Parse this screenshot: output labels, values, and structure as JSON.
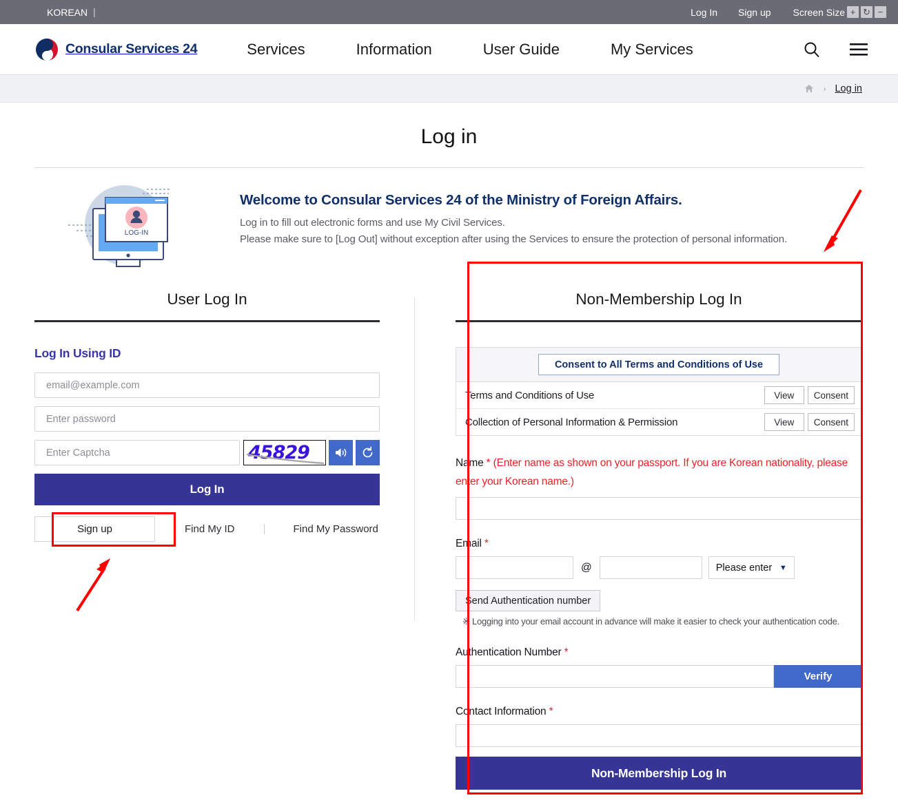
{
  "utilbar": {
    "korean": "KOREAN",
    "separator": "|",
    "login": "Log In",
    "signup": "Sign up",
    "screen_size": "Screen Size",
    "zoom_in": "+",
    "zoom_reset": "↻",
    "zoom_out": "−"
  },
  "header": {
    "logo_text": "Consular Services 24",
    "nav": [
      {
        "label": "Services"
      },
      {
        "label": "Information"
      },
      {
        "label": "User Guide"
      },
      {
        "label": "My Services"
      }
    ],
    "search_icon": "search-icon",
    "menu_icon": "hamburger-menu-icon"
  },
  "breadcrumb": {
    "home_icon": "home-icon",
    "separator": "›",
    "current": "Log in"
  },
  "page": {
    "title": "Log in"
  },
  "welcome": {
    "illustration_label": "LOG-IN",
    "heading": "Welcome to Consular Services 24 of the Ministry of Foreign Affairs.",
    "line1": "Log in to fill out electronic forms and use My Civil Services.",
    "line2": "Please make sure to [Log Out] without exception after using the Services to ensure the protection of personal information."
  },
  "user_login": {
    "panel_title": "User Log In",
    "sub_heading": "Log In Using ID",
    "id_placeholder": "email@example.com",
    "id_value": "",
    "password_placeholder": "Enter password",
    "password_value": "",
    "captcha_placeholder": "Enter Captcha",
    "captcha_value": "",
    "captcha_code": "45829",
    "captcha_audio_icon": "speaker-icon",
    "captcha_refresh_icon": "refresh-icon",
    "login_button": "Log In",
    "signup_button": "Sign up",
    "find_id": "Find My ID",
    "find_password": "Find My Password"
  },
  "non_membership": {
    "panel_title": "Non-Membership Log In",
    "consent_all_button": "Consent to All Terms and Conditions of Use",
    "consent_rows": [
      {
        "label": "Terms and Conditions of Use",
        "view": "View",
        "consent": "Consent"
      },
      {
        "label": "Collection of Personal Information & Permission",
        "view": "View",
        "consent": "Consent"
      }
    ],
    "name_label": "Name",
    "name_required": "*",
    "name_note": "(Enter name as shown on your passport. If you are Korean nationality, please enter your Korean name.)",
    "name_value": "",
    "email_label": "Email",
    "email_required": "*",
    "email_id_value": "",
    "email_at": "@",
    "email_domain_value": "",
    "email_select_value": "Please enter",
    "email_select_caret": "▼",
    "send_auth_button": "Send Authentication number",
    "auth_note": "※ Logging into your email account in advance will make it easier to check your authentication code.",
    "auth_label": "Authentication Number",
    "auth_required": "*",
    "auth_value": "",
    "verify_button": "Verify",
    "contact_label": "Contact Information",
    "contact_required": "*",
    "contact_value": "",
    "submit_button": "Non-Membership Log In"
  },
  "annotations": {
    "highlight_signup": "red-rectangle-around-signup-button",
    "highlight_nonmembership": "red-rectangle-around-non-membership-panel",
    "arrow_to_panel": "red-arrow-pointing-to-non-membership-panel",
    "arrow_to_signup": "red-arrow-pointing-to-signup-button"
  },
  "colors": {
    "brand_navy": "#10306b",
    "primary_button": "#363596",
    "accent_blue": "#4169c9",
    "required_red": "#e8232a",
    "annotation_red": "#ff0000",
    "utilbar_gray": "#6b6b75"
  }
}
